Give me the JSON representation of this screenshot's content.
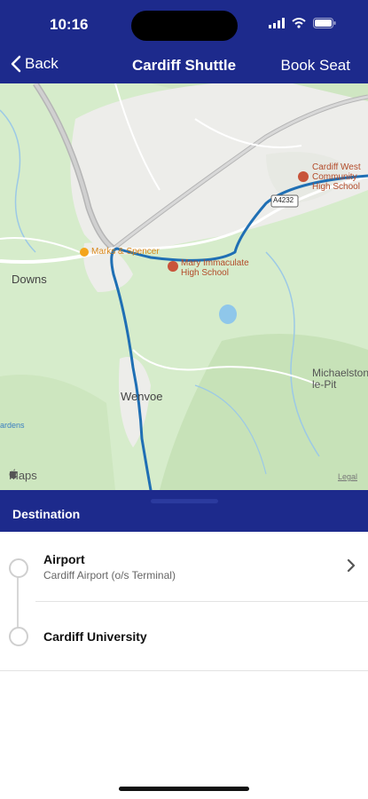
{
  "status": {
    "time": "10:16"
  },
  "nav": {
    "back_label": "Back",
    "title": "Cardiff Shuttle",
    "book_label": "Book Seat"
  },
  "map": {
    "labels": {
      "downs": "Downs",
      "wenvoe": "Wenvoe",
      "michaelston": "Michaelston-le-Pit",
      "gardens": "ardens",
      "road": "A4232",
      "apple_maps": "Maps",
      "legal": "Legal"
    },
    "pois": {
      "ms": "Marks & Spencer",
      "mary": "Mary Immaculate High School",
      "cardiff_west": "Cardiff West Community High School"
    },
    "route_color": "#1f6fb4"
  },
  "destination": {
    "header": "Destination",
    "stops": [
      {
        "name": "Airport",
        "subtitle": "Cardiff Airport (o/s Terminal)"
      },
      {
        "name": "Cardiff University",
        "subtitle": ""
      }
    ]
  }
}
